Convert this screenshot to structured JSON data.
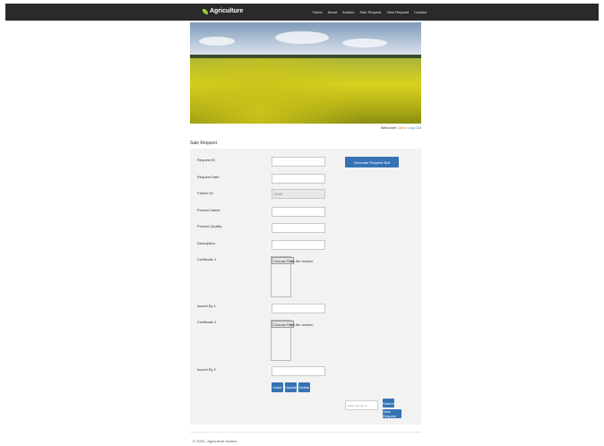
{
  "header": {
    "brand": "Agriculture",
    "nav": [
      "Home",
      "About",
      "Auction",
      "Sale Request",
      "View Request",
      "Contact"
    ]
  },
  "user": {
    "welcome": "Welcome!",
    "name": "Admin",
    "logout": "Log Out"
  },
  "page_title": "Sale Request",
  "form": {
    "request_id_label": "Request ID",
    "request_date_label": "Request Date",
    "farmer_id_label": "Farmer ID",
    "farmer_id_value": "2018",
    "product_name_label": "Product Name",
    "product_quality_label": "Product Quality",
    "description_label": "Description",
    "certificate1_label": "Certificate 1",
    "certificate2_label": "Certificate 2",
    "choose_file": "Choose File",
    "no_file": "No file chosen",
    "issued_by1_label": "Issued By 1",
    "issued_by2_label": "Issued By 2",
    "generate_button": "Generate Request Bull",
    "insert_button": "Insert",
    "update_button": "Update",
    "delete_button": "Delete",
    "search_placeholder": "Enter request id",
    "search_button": "Search",
    "view_request_button": "View Request"
  },
  "footer": "© 2020 - Agriculture Auction",
  "colors": {
    "primary_button": "#3573b5",
    "topbar": "#2a2a2a",
    "panel": "#f2f2f2",
    "admin_highlight": "#e08a2a"
  }
}
